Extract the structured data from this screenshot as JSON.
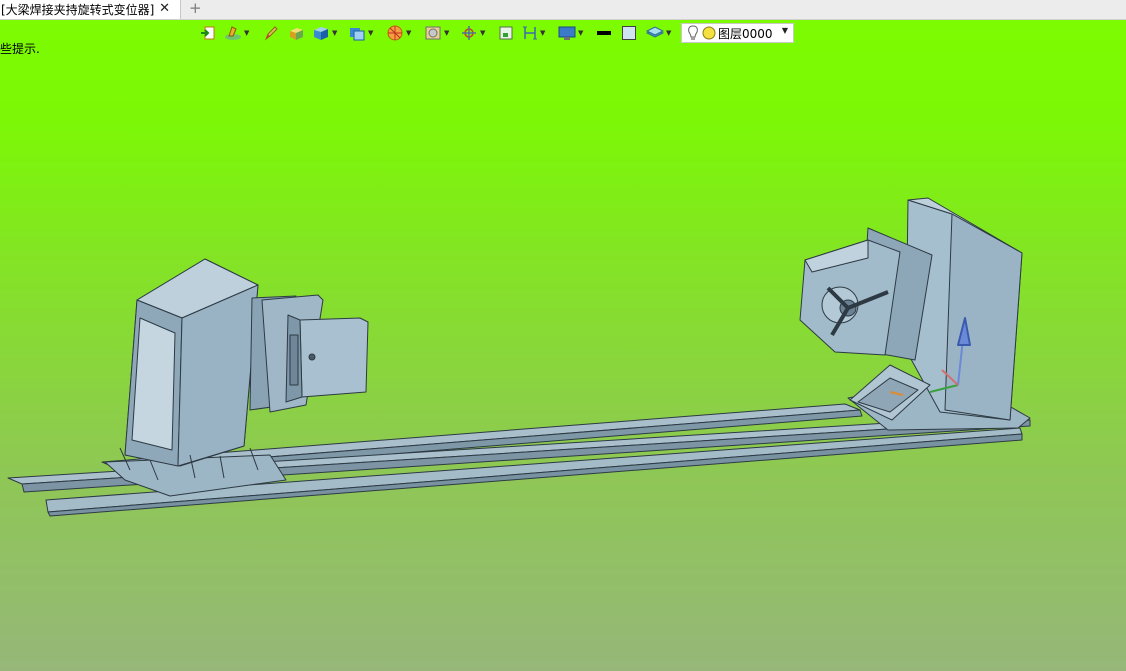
{
  "tab": {
    "title": "[大梁焊接夹持旋转式变位器]",
    "close": "✕",
    "add": "+"
  },
  "toolbar": {
    "buttons": [
      {
        "icon": "exit-icon"
      },
      {
        "icon": "sketch-icon"
      },
      {
        "icon": "pencil-icon"
      },
      {
        "icon": "solid-box-icon"
      },
      {
        "icon": "blue-cube-icon"
      },
      {
        "icon": "display-mode-icon"
      },
      {
        "icon": "section-icon"
      },
      {
        "icon": "render-icon"
      },
      {
        "icon": "origin-icon"
      },
      {
        "icon": "zoom-area-icon"
      },
      {
        "icon": "dimension-icon"
      },
      {
        "icon": "screen-icon"
      },
      {
        "icon": "line-color-icon"
      },
      {
        "icon": "fill-color-icon"
      },
      {
        "icon": "layers-icon"
      }
    ],
    "layer": {
      "name": "图层0000"
    }
  },
  "hint": {
    "text": "些提示."
  },
  "colors": {
    "background_top": "#7cfc00",
    "background_bottom": "#96b779",
    "model": "#9fb8c8"
  }
}
